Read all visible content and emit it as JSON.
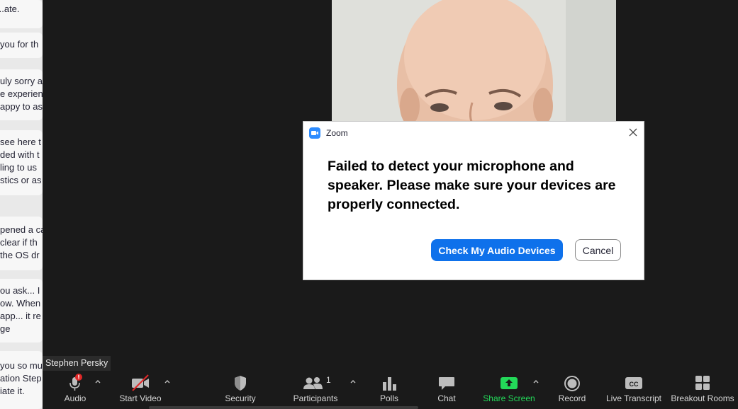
{
  "chat": {
    "messages": [
      {
        "lines": [
          "...ate."
        ]
      },
      {
        "lines": [
          "you for th"
        ]
      },
      {
        "lines": [
          "uly sorry a",
          "e experien",
          "appy to as"
        ]
      },
      {
        "lines": [
          "see here t",
          "ded with t",
          "ling to us",
          "stics or as"
        ]
      },
      {
        "lines": [
          "pened a ca",
          "clear if th",
          "the OS dr"
        ]
      },
      {
        "lines": [
          "ou ask... I",
          "ow.  When",
          "app... it re",
          "ge"
        ]
      },
      {
        "lines": [
          "you so mu",
          "ation Step",
          "iate it."
        ]
      }
    ]
  },
  "dialog": {
    "title": "Zoom",
    "message": "Failed to detect your microphone and speaker. Please make sure your devices are properly connected.",
    "primary_button": "Check My Audio Devices",
    "secondary_button": "Cancel"
  },
  "tooltip": "Stephen Persky",
  "toolbar": {
    "audio": "Audio",
    "start_video": "Start Video",
    "security": "Security",
    "participants": "Participants",
    "participants_count": "1",
    "polls": "Polls",
    "chat": "Chat",
    "share_screen": "Share Screen",
    "record": "Record",
    "live_transcript": "Live Transcript",
    "breakout_rooms": "Breakout Rooms"
  },
  "colors": {
    "accent": "#0e71eb",
    "share_green": "#23d959",
    "alert_red": "#e02828"
  }
}
